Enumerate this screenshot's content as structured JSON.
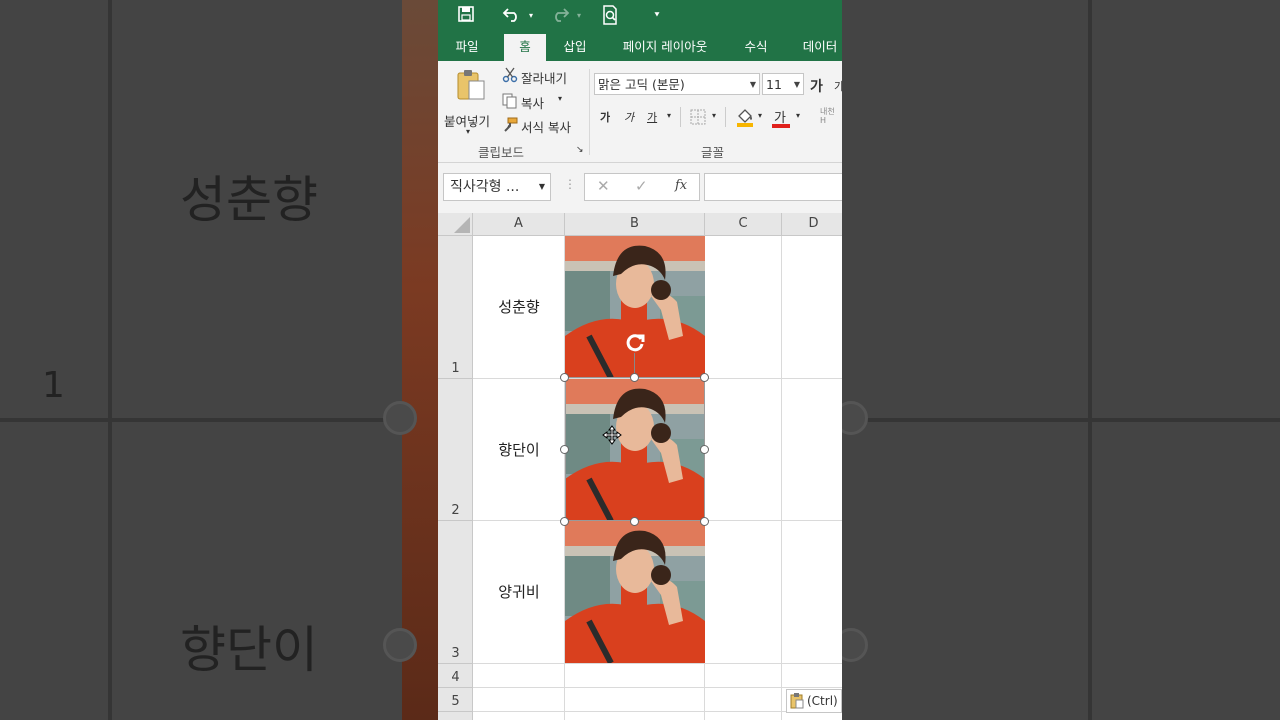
{
  "background": {
    "labels": [
      "성춘향",
      "향단이"
    ],
    "row_number": "1"
  },
  "quick_access": {
    "save_icon": "save-icon",
    "undo_icon": "undo-icon",
    "redo_icon": "redo-icon",
    "print_preview_icon": "print-preview-icon",
    "customize_icon": "customize-icon"
  },
  "tabs": [
    {
      "label": "파일"
    },
    {
      "label": "홈"
    },
    {
      "label": "삽입"
    },
    {
      "label": "페이지 레이아웃"
    },
    {
      "label": "수식"
    },
    {
      "label": "데이터"
    }
  ],
  "ribbon": {
    "clipboard": {
      "paste_label": "붙여넣기",
      "cut_label": "잘라내기",
      "copy_label": "복사",
      "format_painter_label": "서식 복사",
      "group_label": "클립보드"
    },
    "font": {
      "font_name": "맑은 고딕 (본문)",
      "font_size": "11",
      "bold_label": "가",
      "italic_label": "가",
      "underline_label": "가",
      "font_color_label": "가",
      "grow_label": "가",
      "group_label": "글꼴"
    }
  },
  "formula_bar": {
    "name_box": "직사각형 ...",
    "fx": "fx",
    "value": ""
  },
  "grid": {
    "columns": [
      "A",
      "B",
      "C",
      "D"
    ],
    "rows": [
      {
        "number": "1",
        "name": "성춘향"
      },
      {
        "number": "2",
        "name": "향단이"
      },
      {
        "number": "3",
        "name": "양귀비"
      },
      {
        "number": "4",
        "name": ""
      },
      {
        "number": "5",
        "name": ""
      }
    ]
  },
  "paste_options": {
    "label": "(Ctrl)"
  },
  "colors": {
    "excel_green": "#217346",
    "sweater_red": "#d9401e"
  }
}
